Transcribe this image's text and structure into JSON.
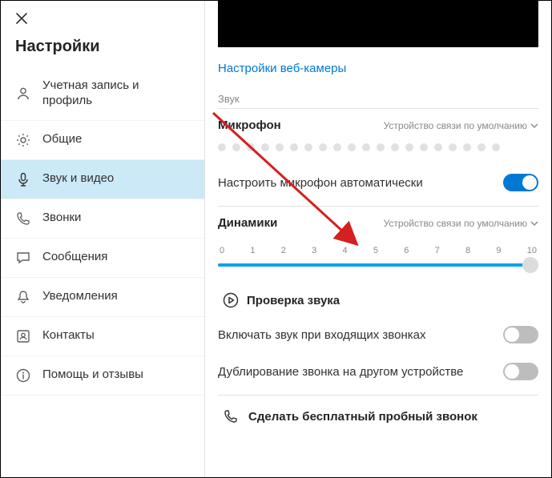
{
  "sidebar": {
    "title": "Настройки",
    "items": [
      {
        "label": "Учетная запись и профиль"
      },
      {
        "label": "Общие"
      },
      {
        "label": "Звук и видео"
      },
      {
        "label": "Звонки"
      },
      {
        "label": "Сообщения"
      },
      {
        "label": "Уведомления"
      },
      {
        "label": "Контакты"
      },
      {
        "label": "Помощь и отзывы"
      }
    ]
  },
  "main": {
    "webcam_settings_link": "Настройки веб-камеры",
    "sound_section": "Звук",
    "microphone": {
      "title": "Микрофон",
      "device": "Устройство связи по умолчанию"
    },
    "auto_adjust_mic": "Настроить микрофон автоматически",
    "speakers": {
      "title": "Динамики",
      "device": "Устройство связи по умолчанию",
      "ticks": [
        "0",
        "1",
        "2",
        "3",
        "4",
        "5",
        "6",
        "7",
        "8",
        "9",
        "10"
      ],
      "value": 10
    },
    "sound_test": "Проверка звука",
    "ring_on_incoming": "Включать звук при входящих звонках",
    "ring_other_device": "Дублирование звонка на другом устройстве",
    "free_test_call": "Сделать бесплатный пробный звонок"
  }
}
